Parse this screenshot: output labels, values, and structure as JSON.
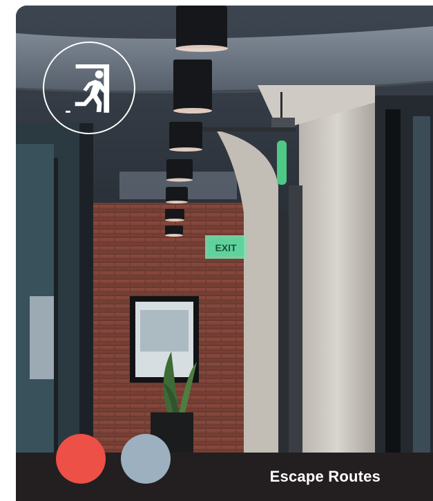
{
  "card": {
    "title": "Escape Routes",
    "badge_icon": "emergency-exit-running-person-icon",
    "swatches": [
      {
        "name": "coral-red",
        "color": "#ec5046"
      },
      {
        "name": "slate-blue-gray",
        "color": "#9cb0c0"
      }
    ],
    "photo_sign_text": "EXIT"
  },
  "colors": {
    "footer": "#231f20",
    "title_text": "#ffffff",
    "exit_sign_green": "#4fd99b"
  }
}
